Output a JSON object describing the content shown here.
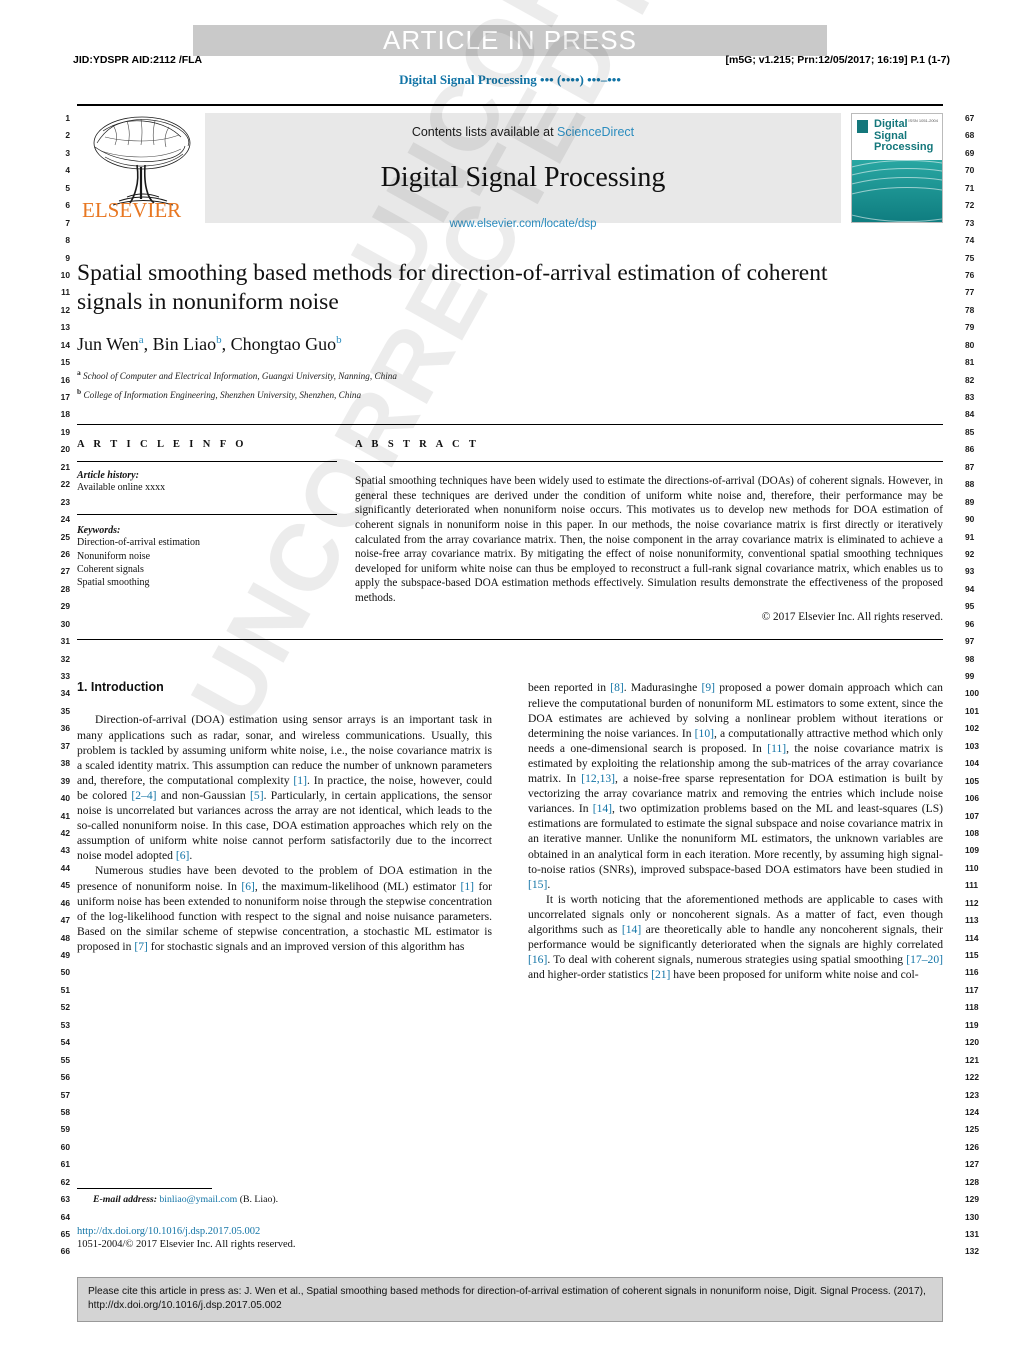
{
  "banner": {
    "text": "ARTICLE IN PRESS"
  },
  "meta": {
    "jid": "JID:YDSPR   AID:2112 /FLA",
    "prn": "[m5G; v1.215; Prn:12/05/2017; 16:19] P.1 (1-7)",
    "running_head": "Digital Signal Processing ••• (••••) •••–•••"
  },
  "masthead": {
    "contents_prefix": "Contents lists available at",
    "sciencedirect": "ScienceDirect",
    "journal_title": "Digital Signal Processing",
    "journal_url": "www.elsevier.com/locate/dsp",
    "publisher": "ELSEVIER",
    "cover_title": "Digital Signal Processing",
    "cover_code": "ISSN 1051-2004"
  },
  "title_block": {
    "title": "Spatial smoothing based methods for direction-of-arrival estimation of coherent signals in nonuniform noise",
    "authors": [
      {
        "name": "Jun Wen",
        "marker": "a",
        "sep": ", "
      },
      {
        "name": "Bin Liao",
        "marker": "b",
        "sep": ", "
      },
      {
        "name": "Chongtao Guo",
        "marker": "b",
        "sep": ""
      }
    ],
    "affiliations": [
      {
        "marker": "a",
        "text": "School of Computer and Electrical Information, Guangxi University, Nanning, China"
      },
      {
        "marker": "b",
        "text": "College of Information Engineering, Shenzhen University, Shenzhen, China"
      }
    ]
  },
  "article_info": {
    "heading": "A R T I C L E   I N F O",
    "history_label": "Article history:",
    "history_lines": [
      "Available online xxxx"
    ],
    "keywords_label": "Keywords:",
    "keywords": [
      "Direction-of-arrival estimation",
      "Nonuniform noise",
      "Coherent signals",
      "Spatial smoothing"
    ]
  },
  "abstract": {
    "heading": "A B S T R A C T",
    "text": "Spatial smoothing techniques have been widely used to estimate the directions-of-arrival (DOAs) of coherent signals. However, in general these techniques are derived under the condition of uniform white noise and, therefore, their performance may be significantly deteriorated when nonuniform noise occurs. This motivates us to develop new methods for DOA estimation of coherent signals in nonuniform noise in this paper. In our methods, the noise covariance matrix is first directly or iteratively calculated from the array covariance matrix. Then, the noise component in the array covariance matrix is eliminated to achieve a noise-free array covariance matrix. By mitigating the effect of noise nonuniformity, conventional spatial smoothing techniques developed for uniform white noise can thus be employed to reconstruct a full-rank signal covariance matrix, which enables us to apply the subspace-based DOA estimation methods effectively. Simulation results demonstrate the effectiveness of the proposed methods.",
    "copyright": "© 2017 Elsevier Inc. All rights reserved."
  },
  "body": {
    "section_heading": "1. Introduction",
    "left_paragraphs": [
      "Direction-of-arrival (DOA) estimation using sensor arrays is an important task in many applications such as radar, sonar, and wireless communications. Usually, this problem is tackled by assuming uniform white noise, i.e., the noise covariance matrix is a scaled identity matrix. This assumption can reduce the number of unknown parameters and, therefore, the computational complexity [1]. In practice, the noise, however, could be colored [2–4] and non-Gaussian [5]. Particularly, in certain applications, the sensor noise is uncorrelated but variances across the array are not identical, which leads to the so-called nonuniform noise. In this case, DOA estimation approaches which rely on the assumption of uniform white noise cannot perform satisfactorily due to the incorrect noise model adopted [6].",
      "Numerous studies have been devoted to the problem of DOA estimation in the presence of nonuniform noise. In [6], the maximum-likelihood (ML) estimator [1] for uniform noise has been extended to nonuniform noise through the stepwise concentration of the log-likelihood function with respect to the signal and noise nuisance parameters. Based on the similar scheme of stepwise concentration, a stochastic ML estimator is proposed in [7] for stochastic signals and an improved version of this algorithm has"
    ],
    "right_paragraphs": [
      "been reported in [8]. Madurasinghe [9] proposed a power domain approach which can relieve the computational burden of nonuniform ML estimators to some extent, since the DOA estimates are achieved by solving a nonlinear problem without iterations or determining the noise variances. In [10], a computationally attractive method which only needs a one-dimensional search is proposed. In [11], the noise covariance matrix is estimated by exploiting the relationship among the sub-matrices of the array covariance matrix. In [12,13], a noise-free sparse representation for DOA estimation is built by vectorizing the array covariance matrix and removing the entries which include noise variances. In [14], two optimization problems based on the ML and least-squares (LS) estimations are formulated to estimate the signal subspace and noise covariance matrix in an iterative manner. Unlike the nonuniform ML estimators, the unknown variables are obtained in an analytical form in each iteration. More recently, by assuming high signal-to-noise ratios (SNRs), improved subspace-based DOA estimators have been studied in [15].",
      "It is worth noticing that the aforementioned methods are applicable to cases with uncorrelated signals only or noncoherent signals. As a matter of fact, even though algorithms such as [14] are theoretically able to handle any noncoherent signals, their performance would be significantly deteriorated when the signals are highly correlated [16]. To deal with coherent signals, numerous strategies using spatial smoothing [17–20] and higher-order statistics [21] have been proposed for uniform white noise and col-"
    ]
  },
  "footnote": {
    "email_label": "E-mail address:",
    "email": "binliao@ymail.com",
    "email_suffix": "(B. Liao).",
    "doi": "http://dx.doi.org/10.1016/j.dsp.2017.05.002",
    "issn": "1051-2004/© 2017 Elsevier Inc. All rights reserved."
  },
  "cite_box": {
    "text": "Please cite this article in press as: J. Wen et al., Spatial smoothing based methods for direction-of-arrival estimation of coherent signals in nonuniform noise, Digit. Signal Process. (2017), http://dx.doi.org/10.1016/j.dsp.2017.05.002"
  },
  "line_numbers": {
    "left_start": 1,
    "left_end": 66,
    "right_start": 67,
    "right_end": 132
  },
  "watermark": {
    "text": "UNCORRECTED PROOF"
  },
  "colors": {
    "link": "#1274a6",
    "sciencedirect": "#2b8cbe",
    "elsevier_orange": "#e87722",
    "banner_bg": "#c9c9c9",
    "masthead_bg": "#e8e8e8",
    "cite_bg": "#d4d4d4",
    "cover_teal": "#1f9b9b"
  }
}
